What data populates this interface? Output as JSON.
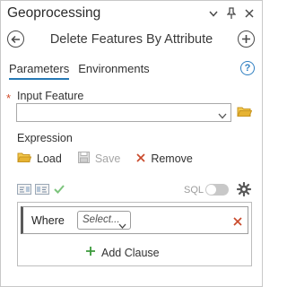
{
  "pane": {
    "title": "Geoprocessing"
  },
  "tool": {
    "title": "Delete Features By Attribute"
  },
  "tabs": [
    {
      "label": "Parameters",
      "active": true
    },
    {
      "label": "Environments",
      "active": false
    }
  ],
  "parameters": {
    "input_feature": {
      "label": "Input Feature",
      "required_marker": "*",
      "value": ""
    },
    "expression": {
      "label": "Expression",
      "toolbar": {
        "load_label": "Load",
        "save_label": "Save",
        "remove_label": "Remove"
      },
      "sql_label": "SQL",
      "sql_toggle_on": false,
      "clause": {
        "where_label": "Where",
        "select_placeholder": "Select..."
      },
      "add_clause_label": "Add Clause"
    }
  },
  "colors": {
    "accent_blue": "#2779b5",
    "folder_yellow": "#e6b333",
    "remove_red": "#c94a2c",
    "add_green": "#3b9a3b",
    "check_green": "#7cc47c"
  },
  "icons": {
    "pane": [
      "chevron-down-icon",
      "pin-icon",
      "close-icon"
    ],
    "tool": [
      "back-arrow-icon",
      "add-icon"
    ],
    "help": "help-icon",
    "expression_row": [
      "sql-view-icon",
      "clause-view-icon",
      "verify-check-icon",
      "settings-gear-icon"
    ]
  }
}
